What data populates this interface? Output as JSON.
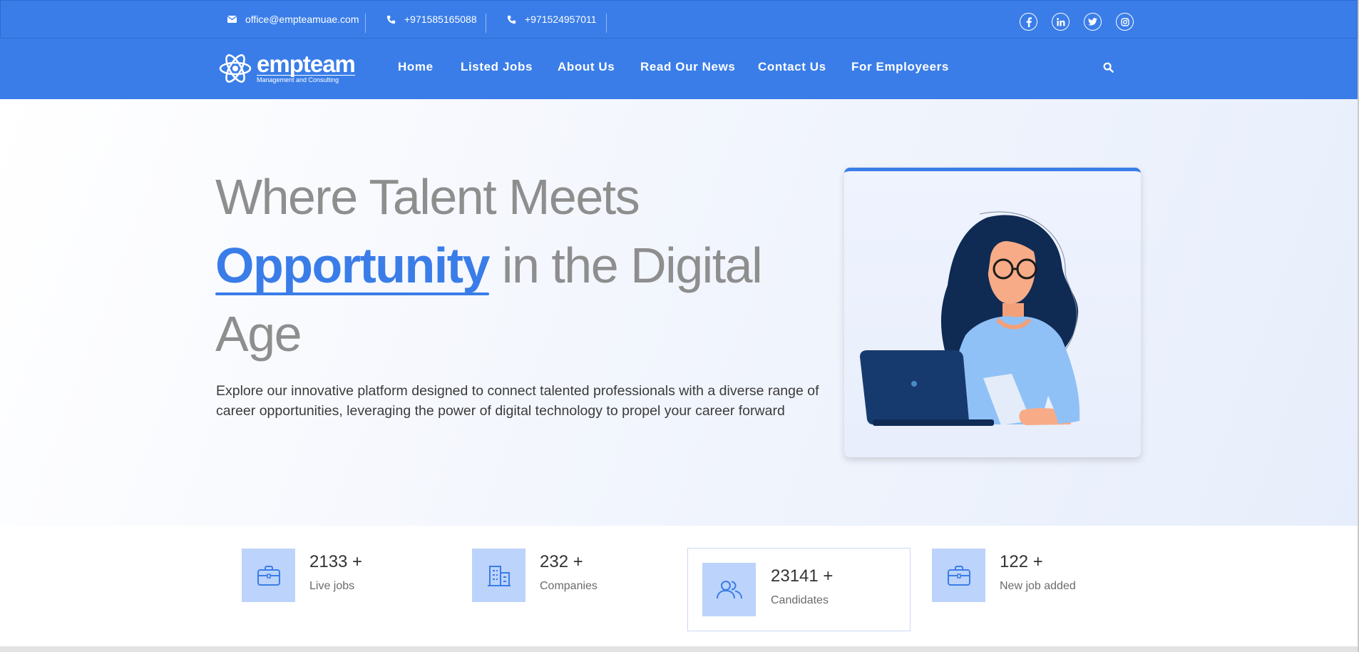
{
  "topbar": {
    "email": "office@empteamuae.com",
    "phone1": "+971585165088",
    "phone2": "+971524957011",
    "social": [
      "facebook-icon",
      "linkedin-icon",
      "twitter-icon",
      "instagram-icon"
    ]
  },
  "logo": {
    "name": "empteam",
    "tagline": "Management and Consulting"
  },
  "nav": {
    "home": "Home",
    "listed_jobs": "Listed Jobs",
    "about": "About Us",
    "news": "Read Our News",
    "contact": "Contact Us",
    "employers": "For Employeers"
  },
  "hero": {
    "line1": "Where Talent Meets",
    "accent": "Opportunity",
    "line2_rest": " in the Digital",
    "line3": "Age",
    "description": "Explore our innovative platform designed to connect talented professionals with a diverse range of career opportunities, leveraging the power of digital technology to propel your career forward"
  },
  "stats": [
    {
      "number": "2133 +",
      "label": "Live jobs",
      "icon": "briefcase-icon"
    },
    {
      "number": "232 +",
      "label": "Companies",
      "icon": "building-icon"
    },
    {
      "number": "23141 +",
      "label": "Candidates",
      "icon": "users-icon"
    },
    {
      "number": "122 +",
      "label": "New job added",
      "icon": "briefcase-icon"
    }
  ],
  "colors": {
    "brand": "#3a7de8",
    "stat_icon_bg": "#bcd3fb"
  }
}
